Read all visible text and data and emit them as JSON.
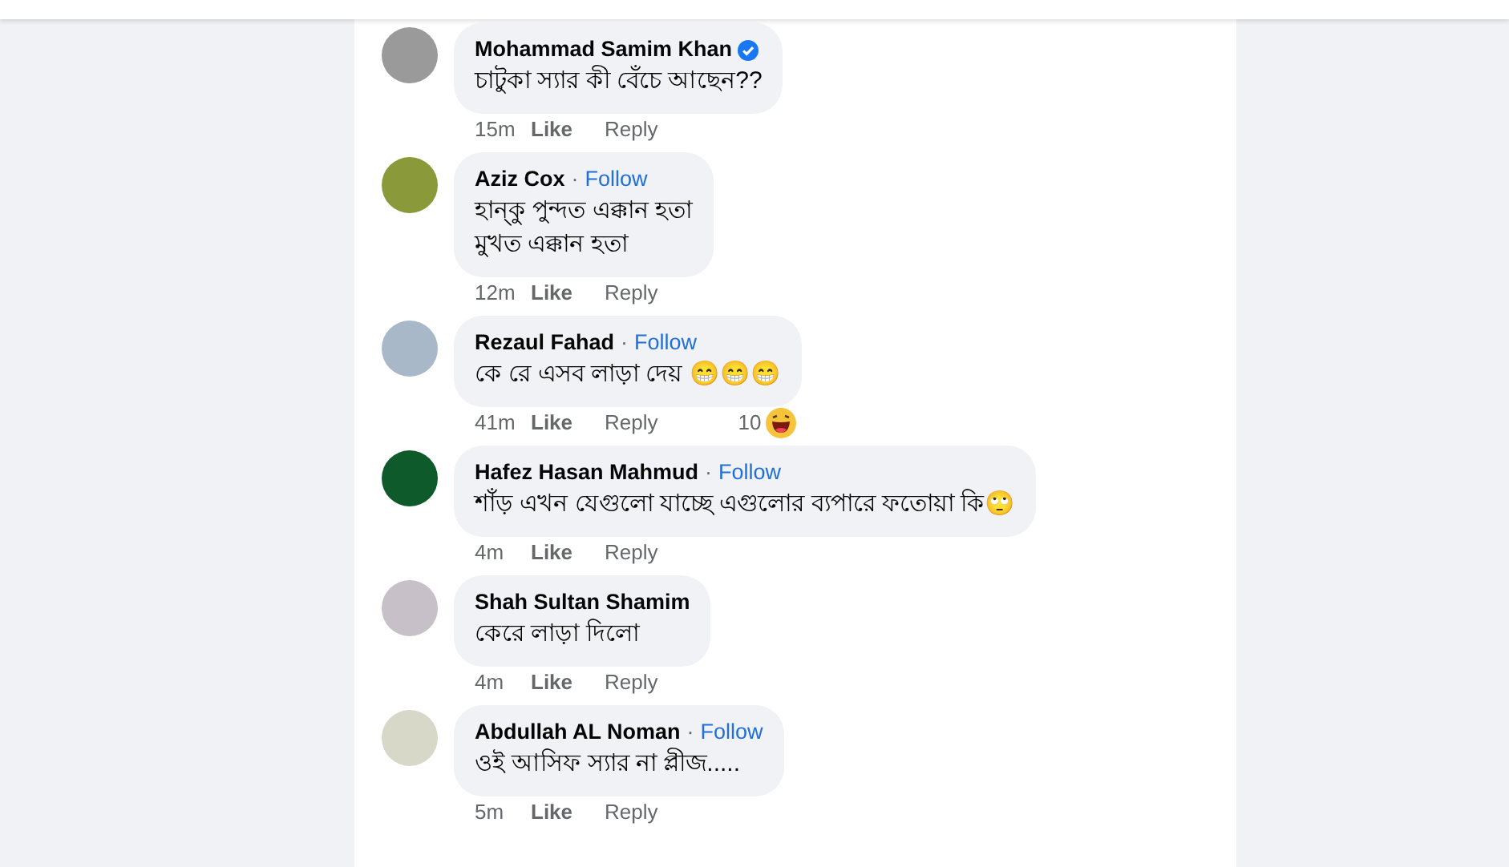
{
  "comments": [
    {
      "author": "Mohammad Samim Khan",
      "verified": true,
      "text": "চাটুকা স্যার কী বেঁচে আছেন??",
      "time": "15m",
      "like": "Like",
      "reply": "Reply"
    },
    {
      "author": "Aziz Cox",
      "verified": false,
      "separator": "·",
      "follow": "Follow",
      "text": "হান্কু পুন্দত এক্কান হতা\nমুখত এক্কান হতা",
      "time": "12m",
      "like": "Like",
      "reply": "Reply"
    },
    {
      "author": "Rezaul Fahad",
      "verified": false,
      "separator": "·",
      "follow": "Follow",
      "text": "কে রে এসব লাড়া দেয় 😁😁😁",
      "time": "41m",
      "like": "Like",
      "reply": "Reply",
      "reactions": "10"
    },
    {
      "author": "Hafez Hasan Mahmud",
      "verified": false,
      "separator": "·",
      "follow": "Follow",
      "text": "শাঁড় এখন যেগুলো যাচ্ছে এগুলোর ব্যপারে ফতোয়া কি🙄",
      "time": "4m",
      "like": "Like",
      "reply": "Reply"
    },
    {
      "author": "Shah Sultan Shamim",
      "verified": false,
      "text": "কেরে লাড়া দিলো",
      "time": "4m",
      "like": "Like",
      "reply": "Reply"
    },
    {
      "author": "Abdullah AL Noman",
      "verified": false,
      "separator": "·",
      "follow": "Follow",
      "text": "ওই আসিফ স্যার না প্লীজ.....",
      "time": "5m",
      "like": "Like",
      "reply": "Reply"
    }
  ]
}
